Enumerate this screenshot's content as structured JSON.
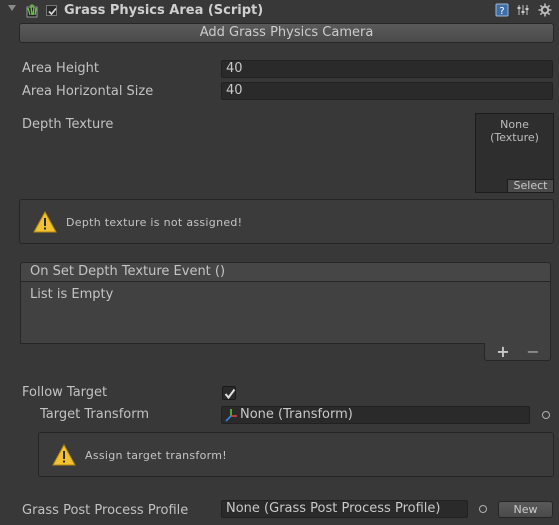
{
  "header": {
    "title": "Grass Physics Area (Script)",
    "icons": [
      "help-book-icon",
      "preset-sliders-icon",
      "gear-icon"
    ]
  },
  "add_camera_button": "Add Grass Physics Camera",
  "fields": {
    "area_height": {
      "label": "Area Height",
      "value": "40"
    },
    "area_horizontal_size": {
      "label": "Area Horizontal Size",
      "value": "40"
    }
  },
  "depth_texture": {
    "label": "Depth Texture",
    "slot_value": "None\n(Texture)",
    "select_label": "Select"
  },
  "warnings": {
    "depth": "Depth texture is not assigned!",
    "target": "Assign target transform!"
  },
  "event": {
    "header": "On Set Depth Texture Event ()",
    "empty": "List is Empty",
    "add": "+",
    "remove": "−"
  },
  "follow_target": {
    "label": "Follow Target",
    "checked": true
  },
  "target_transform": {
    "label": "Target Transform",
    "value": "None (Transform)"
  },
  "post_process": {
    "label": "Grass Post Process Profile",
    "value": "None (Grass Post Process Profile)",
    "new_button": "New"
  },
  "colors": {
    "background": "#383838",
    "warning": "#f2c230",
    "checkmark": "#e0e0e0"
  }
}
